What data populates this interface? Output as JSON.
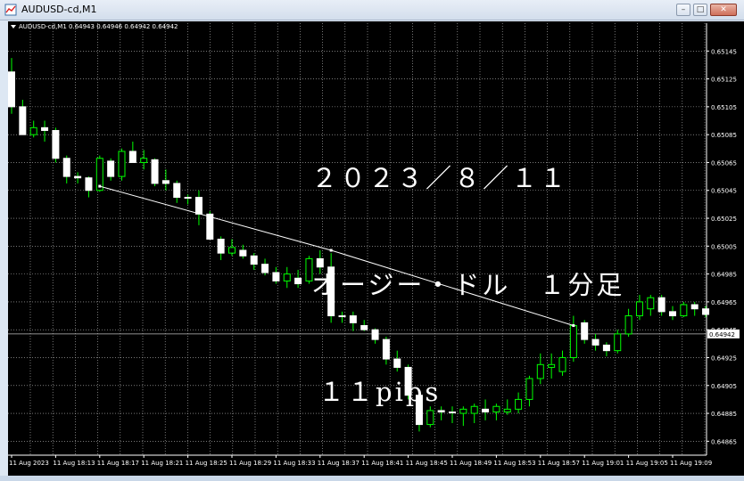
{
  "window": {
    "title": "AUDUSD-cd,M1",
    "min_label": "–",
    "max_label": "□",
    "close_label": "✕",
    "icon": "chart-icon"
  },
  "colors": {
    "background": "#000000",
    "grid": "#c0c0c0",
    "bull_body": "#000000",
    "bull_outline": "#00ff00",
    "bear_body": "#ffffff",
    "wick": "#00ff00",
    "axis_text": "#ffffff",
    "trendline": "#ffffff",
    "price_line": "#c0c0c0"
  },
  "caption": {
    "date": "２０２３／８／１１",
    "pair": "オージー・ドル　１分足",
    "pips": "１１pips"
  },
  "chart_data": {
    "type": "candlestick",
    "symbol_info": "AUDUSD-cd,M1  0.64943 0.64946 0.64942 0.64942",
    "ylim": [
      0.64855,
      0.65165
    ],
    "yticks": [
      0.64865,
      0.64885,
      0.64905,
      0.64925,
      0.64945,
      0.64965,
      0.64985,
      0.65005,
      0.65025,
      0.65045,
      0.65065,
      0.65085,
      0.65105,
      0.65125,
      0.65145
    ],
    "ytick_labels": [
      "0.64865",
      "0.64885",
      "0.64905",
      "0.64925",
      "0.64945",
      "0.64965",
      "0.64985",
      "0.65005",
      "0.65025",
      "0.65045",
      "0.65065",
      "0.65085",
      "0.65105",
      "0.65125",
      "0.65145"
    ],
    "current_price": 0.64942,
    "current_price_label": "0.64942",
    "xtick_labels": [
      "11 Aug 2023",
      "11 Aug 18:13",
      "11 Aug 18:17",
      "11 Aug 18:21",
      "11 Aug 18:25",
      "11 Aug 18:29",
      "11 Aug 18:33",
      "11 Aug 18:37",
      "11 Aug 18:41",
      "11 Aug 18:45",
      "11 Aug 18:49",
      "11 Aug 18:53",
      "11 Aug 18:57",
      "11 Aug 19:01",
      "11 Aug 19:05",
      "11 Aug 19:09"
    ],
    "xtick_bar_index": [
      0,
      4,
      8,
      12,
      16,
      20,
      24,
      28,
      32,
      36,
      40,
      44,
      48,
      52,
      56,
      60
    ],
    "candles": [
      {
        "o": 0.6513,
        "h": 0.6514,
        "l": 0.651,
        "c": 0.65105
      },
      {
        "o": 0.65105,
        "h": 0.6511,
        "l": 0.65085,
        "c": 0.65085
      },
      {
        "o": 0.65085,
        "h": 0.65095,
        "l": 0.65083,
        "c": 0.6509
      },
      {
        "o": 0.6509,
        "h": 0.65095,
        "l": 0.6508,
        "c": 0.65088
      },
      {
        "o": 0.65088,
        "h": 0.6509,
        "l": 0.65065,
        "c": 0.65068
      },
      {
        "o": 0.65068,
        "h": 0.6507,
        "l": 0.6505,
        "c": 0.65055
      },
      {
        "o": 0.65055,
        "h": 0.65058,
        "l": 0.6505,
        "c": 0.65054
      },
      {
        "o": 0.65054,
        "h": 0.65055,
        "l": 0.6504,
        "c": 0.65045
      },
      {
        "o": 0.65045,
        "h": 0.6507,
        "l": 0.65044,
        "c": 0.65068
      },
      {
        "o": 0.65066,
        "h": 0.65068,
        "l": 0.65052,
        "c": 0.65055
      },
      {
        "o": 0.65055,
        "h": 0.65075,
        "l": 0.65052,
        "c": 0.65073
      },
      {
        "o": 0.65073,
        "h": 0.6508,
        "l": 0.65065,
        "c": 0.65065
      },
      {
        "o": 0.65065,
        "h": 0.65074,
        "l": 0.6506,
        "c": 0.65068
      },
      {
        "o": 0.65067,
        "h": 0.65068,
        "l": 0.65048,
        "c": 0.6505
      },
      {
        "o": 0.65052,
        "h": 0.6506,
        "l": 0.65045,
        "c": 0.6505
      },
      {
        "o": 0.6505,
        "h": 0.65052,
        "l": 0.65036,
        "c": 0.6504
      },
      {
        "o": 0.6504,
        "h": 0.65042,
        "l": 0.65035,
        "c": 0.6504
      },
      {
        "o": 0.6504,
        "h": 0.65045,
        "l": 0.6502,
        "c": 0.65028
      },
      {
        "o": 0.65028,
        "h": 0.6503,
        "l": 0.6501,
        "c": 0.6501
      },
      {
        "o": 0.6501,
        "h": 0.65012,
        "l": 0.64995,
        "c": 0.65
      },
      {
        "o": 0.65,
        "h": 0.6501,
        "l": 0.64998,
        "c": 0.65004
      },
      {
        "o": 0.65002,
        "h": 0.65006,
        "l": 0.64996,
        "c": 0.64998
      },
      {
        "o": 0.64998,
        "h": 0.65,
        "l": 0.64988,
        "c": 0.64992
      },
      {
        "o": 0.64992,
        "h": 0.64996,
        "l": 0.64984,
        "c": 0.64986
      },
      {
        "o": 0.64986,
        "h": 0.6499,
        "l": 0.64978,
        "c": 0.6498
      },
      {
        "o": 0.6498,
        "h": 0.6499,
        "l": 0.64975,
        "c": 0.64985
      },
      {
        "o": 0.64982,
        "h": 0.64988,
        "l": 0.64975,
        "c": 0.64978
      },
      {
        "o": 0.6498,
        "h": 0.64998,
        "l": 0.64978,
        "c": 0.64996
      },
      {
        "o": 0.64996,
        "h": 0.65002,
        "l": 0.64985,
        "c": 0.6499
      },
      {
        "o": 0.6499,
        "h": 0.65,
        "l": 0.6495,
        "c": 0.64955
      },
      {
        "o": 0.64955,
        "h": 0.64958,
        "l": 0.6495,
        "c": 0.64955
      },
      {
        "o": 0.64955,
        "h": 0.64958,
        "l": 0.64944,
        "c": 0.6495
      },
      {
        "o": 0.64948,
        "h": 0.64952,
        "l": 0.64944,
        "c": 0.64945
      },
      {
        "o": 0.64945,
        "h": 0.64946,
        "l": 0.64935,
        "c": 0.64938
      },
      {
        "o": 0.64938,
        "h": 0.6494,
        "l": 0.6492,
        "c": 0.64924
      },
      {
        "o": 0.64924,
        "h": 0.6493,
        "l": 0.64915,
        "c": 0.64918
      },
      {
        "o": 0.64918,
        "h": 0.6492,
        "l": 0.64895,
        "c": 0.64898
      },
      {
        "o": 0.64898,
        "h": 0.649,
        "l": 0.64872,
        "c": 0.64877
      },
      {
        "o": 0.64877,
        "h": 0.6489,
        "l": 0.64875,
        "c": 0.64887
      },
      {
        "o": 0.64887,
        "h": 0.6489,
        "l": 0.6488,
        "c": 0.64886
      },
      {
        "o": 0.64886,
        "h": 0.6489,
        "l": 0.64878,
        "c": 0.64886
      },
      {
        "o": 0.64885,
        "h": 0.6489,
        "l": 0.64876,
        "c": 0.64888
      },
      {
        "o": 0.64885,
        "h": 0.64892,
        "l": 0.64878,
        "c": 0.6489
      },
      {
        "o": 0.64888,
        "h": 0.64895,
        "l": 0.6488,
        "c": 0.64886
      },
      {
        "o": 0.64886,
        "h": 0.64892,
        "l": 0.6488,
        "c": 0.6489
      },
      {
        "o": 0.64886,
        "h": 0.64895,
        "l": 0.64884,
        "c": 0.64888
      },
      {
        "o": 0.64888,
        "h": 0.649,
        "l": 0.64885,
        "c": 0.64895
      },
      {
        "o": 0.64895,
        "h": 0.64912,
        "l": 0.6489,
        "c": 0.6491
      },
      {
        "o": 0.6491,
        "h": 0.64928,
        "l": 0.64906,
        "c": 0.6492
      },
      {
        "o": 0.64918,
        "h": 0.64928,
        "l": 0.6491,
        "c": 0.6492
      },
      {
        "o": 0.64915,
        "h": 0.6493,
        "l": 0.64912,
        "c": 0.64925
      },
      {
        "o": 0.64925,
        "h": 0.64955,
        "l": 0.64922,
        "c": 0.64948
      },
      {
        "o": 0.6495,
        "h": 0.64952,
        "l": 0.64935,
        "c": 0.64938
      },
      {
        "o": 0.64938,
        "h": 0.64942,
        "l": 0.6493,
        "c": 0.64934
      },
      {
        "o": 0.64934,
        "h": 0.64936,
        "l": 0.64926,
        "c": 0.6493
      },
      {
        "o": 0.6493,
        "h": 0.64945,
        "l": 0.64928,
        "c": 0.64942
      },
      {
        "o": 0.64942,
        "h": 0.6496,
        "l": 0.6494,
        "c": 0.64955
      },
      {
        "o": 0.64955,
        "h": 0.6497,
        "l": 0.64952,
        "c": 0.64965
      },
      {
        "o": 0.6496,
        "h": 0.6497,
        "l": 0.64955,
        "c": 0.64968
      },
      {
        "o": 0.64968,
        "h": 0.6497,
        "l": 0.64955,
        "c": 0.64958
      },
      {
        "o": 0.64958,
        "h": 0.64962,
        "l": 0.64952,
        "c": 0.64955
      },
      {
        "o": 0.64955,
        "h": 0.64965,
        "l": 0.64954,
        "c": 0.64963
      },
      {
        "o": 0.64963,
        "h": 0.64965,
        "l": 0.64955,
        "c": 0.6496
      },
      {
        "o": 0.6496,
        "h": 0.64962,
        "l": 0.64954,
        "c": 0.64956
      }
    ],
    "trendline": [
      {
        "bar": 8,
        "price": 0.65048
      },
      {
        "bar": 29,
        "price": 0.65002
      },
      {
        "bar": 51,
        "price": 0.64948
      }
    ]
  }
}
